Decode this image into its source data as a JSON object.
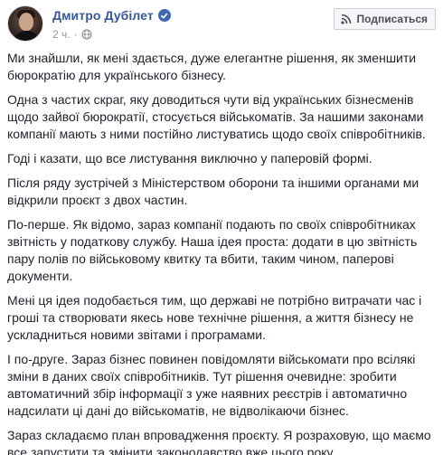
{
  "author": {
    "name": "Дмитро Дубілет",
    "timestamp": "2 ч."
  },
  "subscribe_button": {
    "label": "Подписаться"
  },
  "icons": {
    "verified": "verified-badge-icon",
    "audience": "globe-icon",
    "subscribe": "rss-icon"
  },
  "colors": {
    "author_link": "#385898",
    "verified_badge": "#4267b2",
    "meta_text": "#90949c",
    "body_text": "#1d2129"
  },
  "post": {
    "paragraphs": [
      "Ми знайшли, як мені здається, дуже елегантне рішення, як зменшити\nбюрократію для українського бізнесу.",
      "Одна з частих скраг, яку доводиться чути від українських бізнесменів\nщодо зайвої бюрократії, стосується військоматів. За нашими законами\nкомпанії мають з ними постійно листуватись щодо своїх співробітників.",
      "Годі і казати, що все листування виключно у паперовій формі.",
      "Після ряду зустрічей з Міністерством оборони та іншими органами ми\nвідкрили проєкт з двох частин.",
      "По-перше. Як відомо, зараз компанії подають по своїх співробітниках\nзвітність у податкову службу. Наша ідея проста: додати в цю звітність\nпару полів по військовому квитку та вбити, таким чином, паперові\nдокументи.",
      "Мені ця ідея подобається тим, що державі не потрібно витрачати час і\nгроші та створювати якесь нове технічне рішення, а життя бізнесу не\nускладниться новими звітами і програмами.",
      "І по-друге. Зараз бізнес повинен повідомляти військомати про всілякі\nзміни в даних своїх співробітників. Тут рішення очевидне: зробити\nавтоматичний збір інформації з уже наявних реєстрів і автоматично\nнадсилати ці дані до військоматів, не відволікаючи бізнес.",
      "Зараз складаємо план впровадження проєкту. Я розраховую, що маємо\nвсе запустити та змінити законодавство вже цього року."
    ]
  }
}
